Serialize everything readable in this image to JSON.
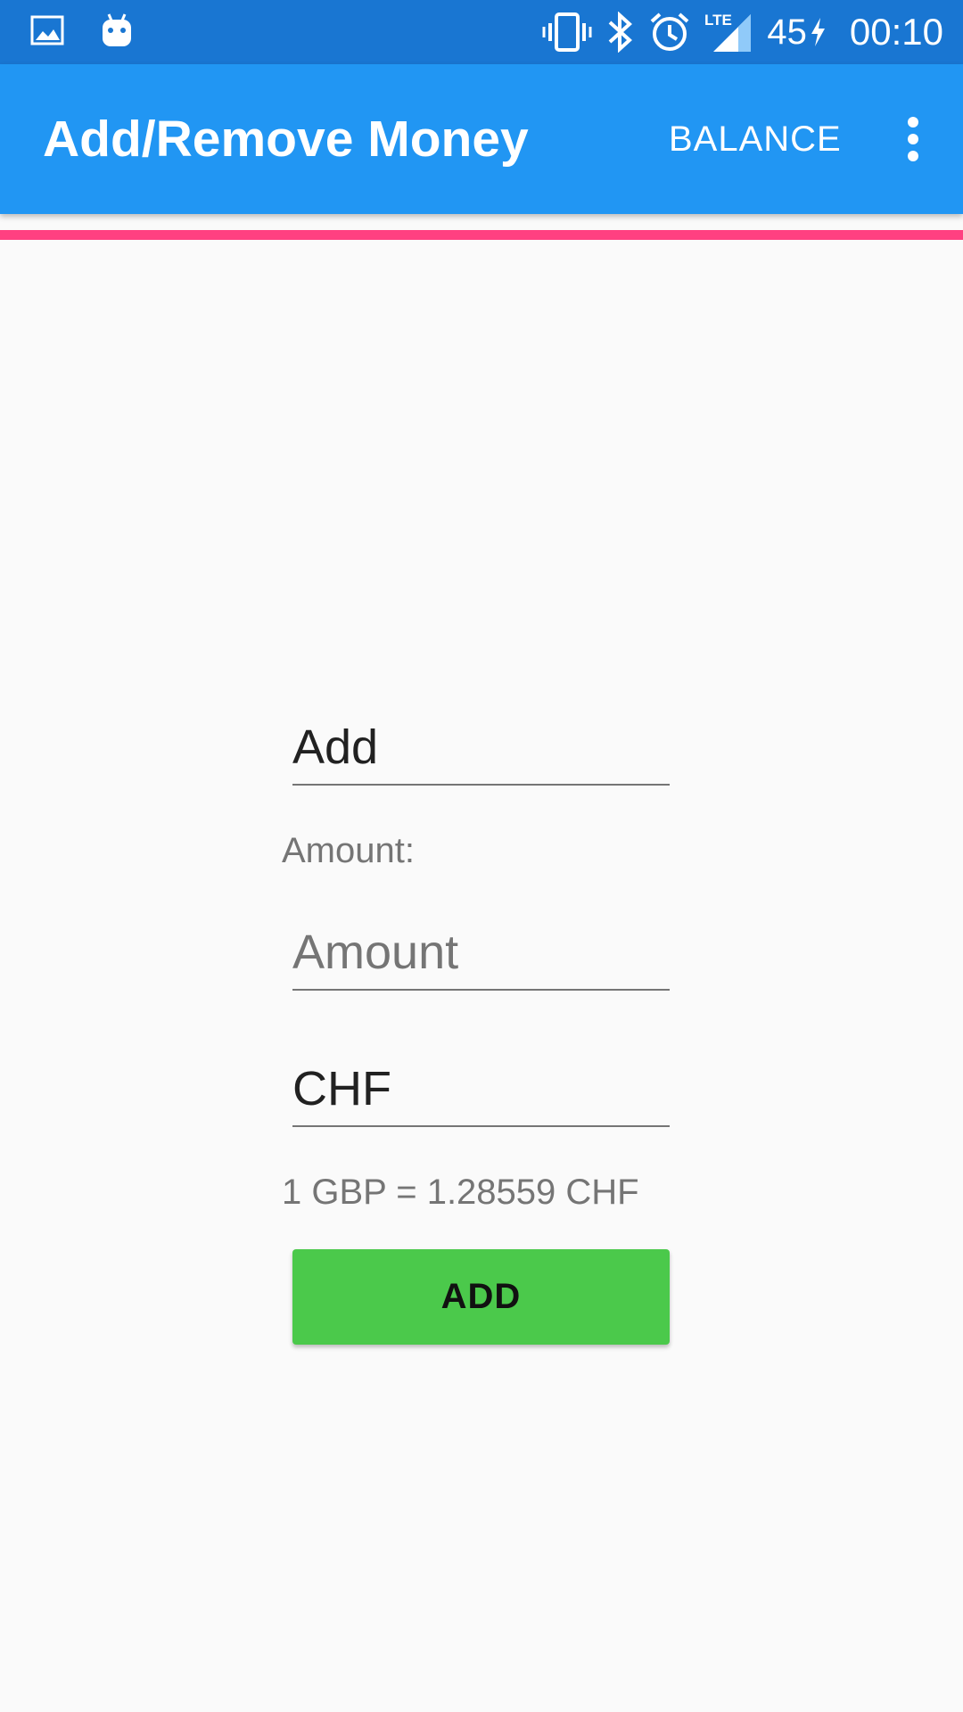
{
  "status_bar": {
    "notification_icons": [
      "image-icon",
      "android-icon"
    ],
    "system_icons": [
      "vibrate-icon",
      "bluetooth-icon",
      "alarm-icon",
      "lte-signal-icon"
    ],
    "network_label": "LTE",
    "battery_level": "45",
    "battery_charging": true,
    "time": "00:10"
  },
  "app_bar": {
    "title": "Add/Remove Money",
    "action_label": "BALANCE",
    "menu_icon": "more-vert-icon",
    "background_color": "#2196f3",
    "status_color": "#1976d2"
  },
  "accent_line_color": "#ff4081",
  "form": {
    "operation_value": "Add",
    "amount_label": "Amount:",
    "amount_placeholder": "Amount",
    "currency_value": "CHF",
    "exchange_rate_text": "1 GBP = 1.28559 CHF",
    "submit_label": "ADD",
    "submit_color": "#4bc94b"
  }
}
